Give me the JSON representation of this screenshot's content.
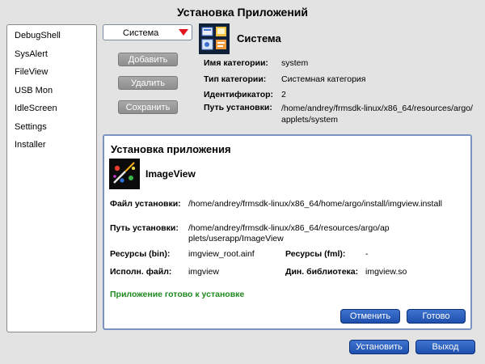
{
  "window": {
    "title": "Установка Приложений"
  },
  "sidebar": {
    "items": [
      {
        "label": "DebugShell"
      },
      {
        "label": "SysAlert"
      },
      {
        "label": "FileView"
      },
      {
        "label": "USB Mon"
      },
      {
        "label": "IdleScreen"
      },
      {
        "label": "Settings"
      },
      {
        "label": "Installer"
      }
    ]
  },
  "category_select": {
    "value": "Система",
    "arrow_icon": "dropdown-arrow-icon",
    "arrow_color": "#e0151b"
  },
  "category_buttons": {
    "add": "Добавить",
    "remove": "Удалить",
    "save": "Сохранить"
  },
  "category": {
    "icon": "system-category-icon",
    "name": "Система",
    "fields": {
      "name_label": "Имя категории:",
      "name_value": "system",
      "type_label": "Тип категории:",
      "type_value": "Системная категория",
      "id_label": "Идентификатор:",
      "id_value": "2",
      "path_label": "Путь установки:",
      "path_value": "/home/andrey/frmsdk-linux/x86_64/resources/argo/applets/system"
    }
  },
  "install_panel": {
    "title": "Установка приложения",
    "app_icon": "imageview-app-icon",
    "app_name": "ImageView",
    "file_label": "Файл установки:",
    "file_value": "/home/andrey/frmsdk-linux/x86_64/home/argo/install/imgview.install",
    "path_label": "Путь установки:",
    "path_value": "/home/andrey/frmsdk-linux/x86_64/resources/argo/applets/userapp/ImageView",
    "res_bin_label": "Ресурсы (bin):",
    "res_bin_value": "imgview_root.ainf",
    "res_fml_label": "Ресурсы (fml):",
    "res_fml_value": "-",
    "exec_label": "Исполн. файл:",
    "exec_value": "imgview",
    "lib_label": "Дин. библиотека:",
    "lib_value": "imgview.so",
    "status": "Приложение готово к установке",
    "status_color": "#1f8a1f",
    "cancel": "Отменить",
    "done": "Готово"
  },
  "footer": {
    "install": "Установить",
    "exit": "Выход"
  },
  "colors": {
    "accent": "#2a5bbd",
    "panel_border": "#7a93c3",
    "grey_button": "#9b9b9b"
  }
}
